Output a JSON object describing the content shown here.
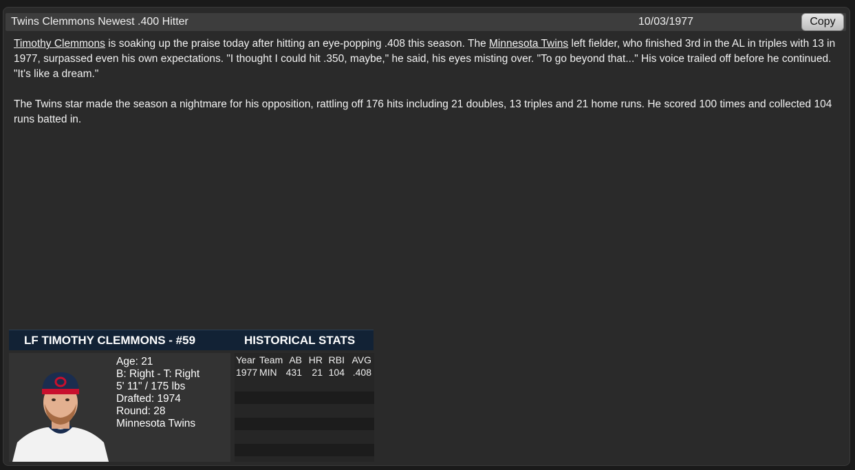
{
  "news": {
    "headline": "Twins Clemmons Newest .400 Hitter",
    "date": "10/03/1977",
    "copy_label": "Copy",
    "p1": {
      "player_link": "Timothy Clemmons",
      "t1": " is soaking up the praise today after hitting an eye-popping .408 this season. The ",
      "team_link": "Minnesota Twins",
      "t2": " left fielder, who finished 3rd in the AL in triples with 13 in 1977, surpassed even his own expectations. \"I thought I could hit .350, maybe,\" he said, his eyes misting over. \"To go beyond that...\" His voice trailed off before he continued. \"It's like a dream.\""
    },
    "p2": "The Twins star made the season a nightmare for his opposition, rattling off 176 hits including 21 doubles, 13 triples and 21 home runs. He scored 100 times and collected 104 runs batted in."
  },
  "player_card": {
    "title": "LF TIMOTHY CLEMMONS - #59",
    "stats_title": "HISTORICAL STATS",
    "bio": {
      "age": "Age: 21",
      "bats_throws": "B: Right - T: Right",
      "size": "5' 11\" / 175 lbs",
      "drafted": "Drafted: 1974",
      "round": "Round: 28",
      "team": "Minnesota Twins"
    },
    "stats": {
      "headers": [
        "Year",
        "Team",
        "AB",
        "HR",
        "RBI",
        "AVG"
      ],
      "rows": [
        [
          "1977",
          "MIN",
          "431",
          "21",
          "104",
          ".408"
        ]
      ]
    }
  },
  "colors": {
    "card_header": "#122235",
    "cap": "#1a2d4f",
    "cap_logo": "#c8102e"
  }
}
